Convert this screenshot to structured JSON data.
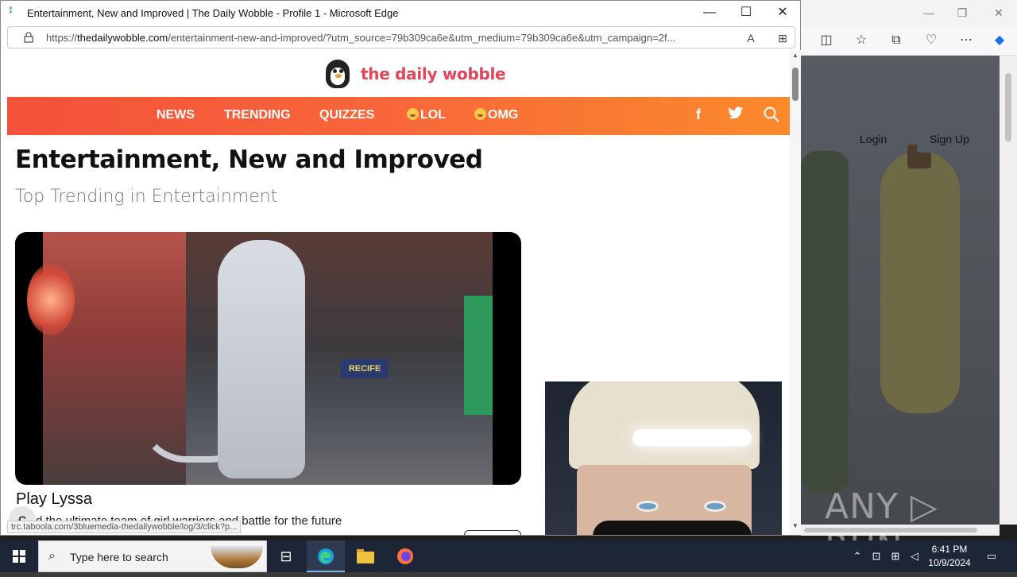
{
  "window": {
    "title": "Entertainment, New and Improved | The Daily Wobble - Profile 1 - Microsoft Edge",
    "controls": {
      "minimize": "—",
      "maximize": "☐",
      "close": "✕"
    }
  },
  "address_bar": {
    "url_prefix": "https://",
    "url_domain": "thedailywobble.com",
    "url_rest": "/entertainment-new-and-improved/?utm_source=79b309ca6e&utm_medium=79b309ca6e&utm_campaign=2f..."
  },
  "site": {
    "logo_text": "the daily wobble",
    "nav": [
      {
        "label": "NEWS"
      },
      {
        "label": "TRENDING"
      },
      {
        "label": "QUIZZES"
      },
      {
        "label": "LOL"
      },
      {
        "label": "OMG"
      }
    ],
    "social": {
      "facebook": "f",
      "twitter": "🐦",
      "search": "⌕"
    }
  },
  "article": {
    "headline": "Entertainment, New and Improved",
    "subhead": "Top Trending in Entertainment"
  },
  "video": {
    "sign_text": "RECIFE"
  },
  "ad": {
    "title": "Play Lyssa",
    "description": "Lead the ultimate team of girl warriors and battle for the future"
  },
  "status_link": "trc.taboola.com/3bluemedia-thedailywobble/log/3/click?p...",
  "chat_button": "C",
  "background_window": {
    "login": "Login",
    "signup": "Sign Up"
  },
  "watermark": "ANY ▷ RUN",
  "taskbar": {
    "search_placeholder": "Type here to search",
    "time": "6:41 PM",
    "date": "10/9/2024"
  }
}
